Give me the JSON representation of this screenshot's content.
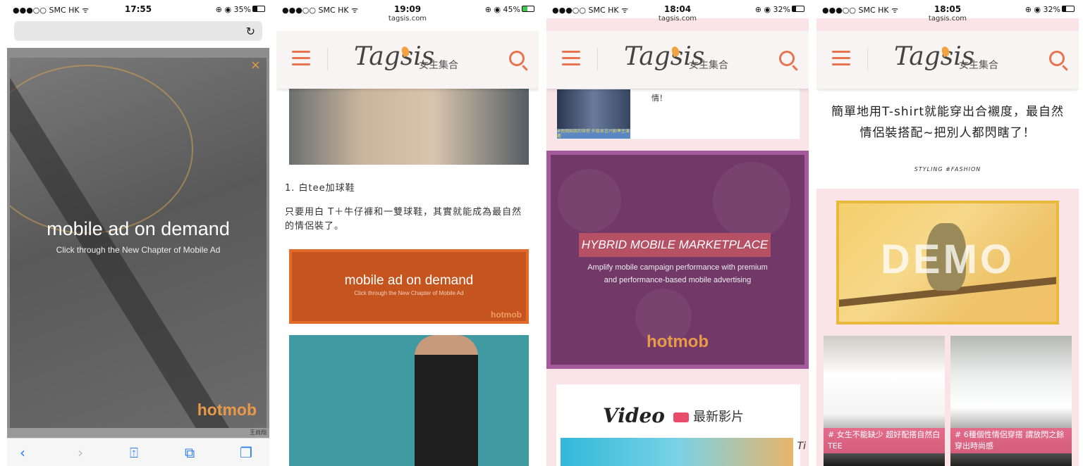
{
  "screens": [
    {
      "status": {
        "carrier": "●●●○○ SMC HK ᯤ",
        "time": "17:55",
        "battery": "⊕ ◉ 35%",
        "battery_level": 0.35
      },
      "safari": {
        "url_text": "",
        "reload_icon": "reload-icon"
      },
      "ad": {
        "headline": "mobile ad on demand",
        "subline": "Click through the New Chapter of Mobile Ad",
        "brand": "hotmob",
        "close": "×"
      },
      "strip_text": "王尚翔",
      "toolbar": {
        "back": "‹",
        "forward": "›",
        "share": "⍐",
        "bookmarks": "⧉",
        "tabs": "❐"
      }
    },
    {
      "status": {
        "carrier": "●●●○○ SMC HK ᯤ",
        "time": "19:09",
        "domain": "tagsis.com",
        "battery": "⊕ ◉ 45%",
        "battery_level": 0.45
      },
      "header": {
        "brand": "Tagsis",
        "brand_sub": "女生集合"
      },
      "article": {
        "heading": "1. 白tee加球鞋",
        "body": "只要用白 T＋牛仔褲和一雙球鞋，其實就能成為最自然的情侶裝了。"
      },
      "ad": {
        "headline": "mobile ad on demand",
        "subline": "Click through the New Chapter of Mobile Ad",
        "brand": "hotmob"
      }
    },
    {
      "status": {
        "carrier": "●●●○○ SMC HK ᯤ",
        "time": "18:04",
        "domain": "tagsis.com",
        "battery": "⊕ ◉ 32%",
        "battery_level": 0.32
      },
      "header": {
        "brand": "Tagsis",
        "brand_sub": "女生集合"
      },
      "card": {
        "text": "情！",
        "thumb_caption": "#佐開始我的穿搭 外版本言六影準主演著"
      },
      "ad": {
        "headline": "HYBRID MOBILE MARKETPLACE",
        "sub1": "Amplify mobile campaign performance with premium",
        "sub2": "and performance-based mobile advertising",
        "brand": "hotmob"
      },
      "video": {
        "title": "Video",
        "subtitle": "最新影片",
        "side": "Ti"
      }
    },
    {
      "status": {
        "carrier": "●●●○○ SMC HK ᯤ",
        "time": "18:05",
        "domain": "tagsis.com",
        "battery": "⊕ ◉ 32%",
        "battery_level": 0.32
      },
      "header": {
        "brand": "Tagsis",
        "brand_sub": "女生集合"
      },
      "article": {
        "title": "簡單地用T-shirt就能穿出合襯度，最自然情侶裝搭配~把別人都閃瞎了！",
        "tags": "STYLING   #FASHION"
      },
      "demo": {
        "text": "DEMO"
      },
      "tiles": [
        {
          "caption": "# 女生不能缺少 超好配搭自然白TEE"
        },
        {
          "caption": "# 6種個性情侶穿搭 謂放閃之餘穿出時尚感"
        }
      ]
    }
  ]
}
